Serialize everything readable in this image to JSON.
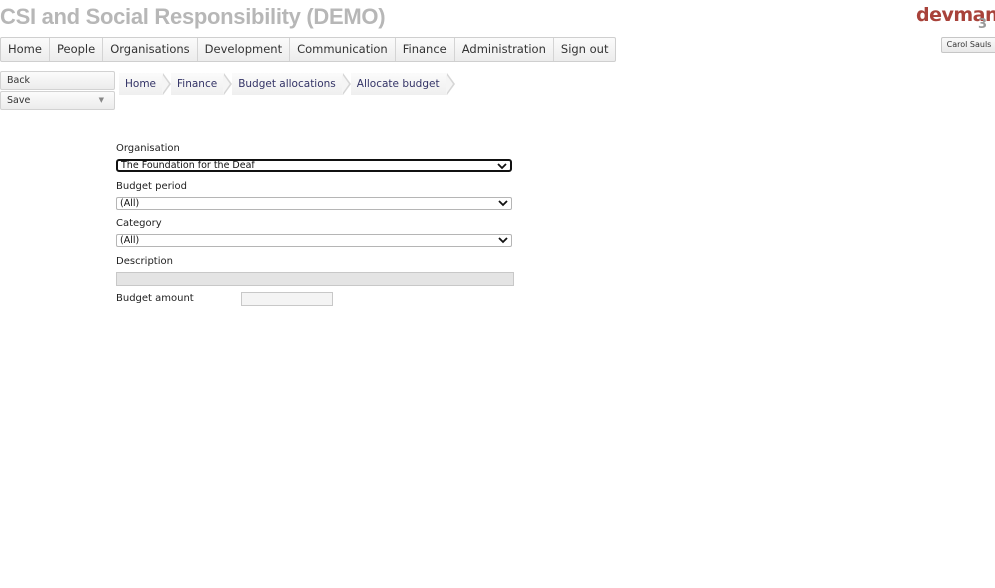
{
  "app": {
    "title": "CSI and Social Responsibility (DEMO)",
    "logo_text": "devman",
    "logo_badge": "3",
    "user_name": "Carol Sauls"
  },
  "nav": {
    "items": [
      "Home",
      "People",
      "Organisations",
      "Development",
      "Communication",
      "Finance",
      "Administration",
      "Sign out"
    ]
  },
  "actions": {
    "back_label": "Back",
    "save_label": "Save"
  },
  "breadcrumb": [
    "Home",
    "Finance",
    "Budget allocations",
    "Allocate budget"
  ],
  "form": {
    "organisation_label": "Organisation",
    "organisation_value": "The Foundation for the Deaf",
    "budget_period_label": "Budget period",
    "budget_period_value": "(All)",
    "category_label": "Category",
    "category_value": "(All)",
    "description_label": "Description",
    "description_value": "",
    "budget_amount_label": "Budget amount",
    "budget_amount_value": ""
  }
}
